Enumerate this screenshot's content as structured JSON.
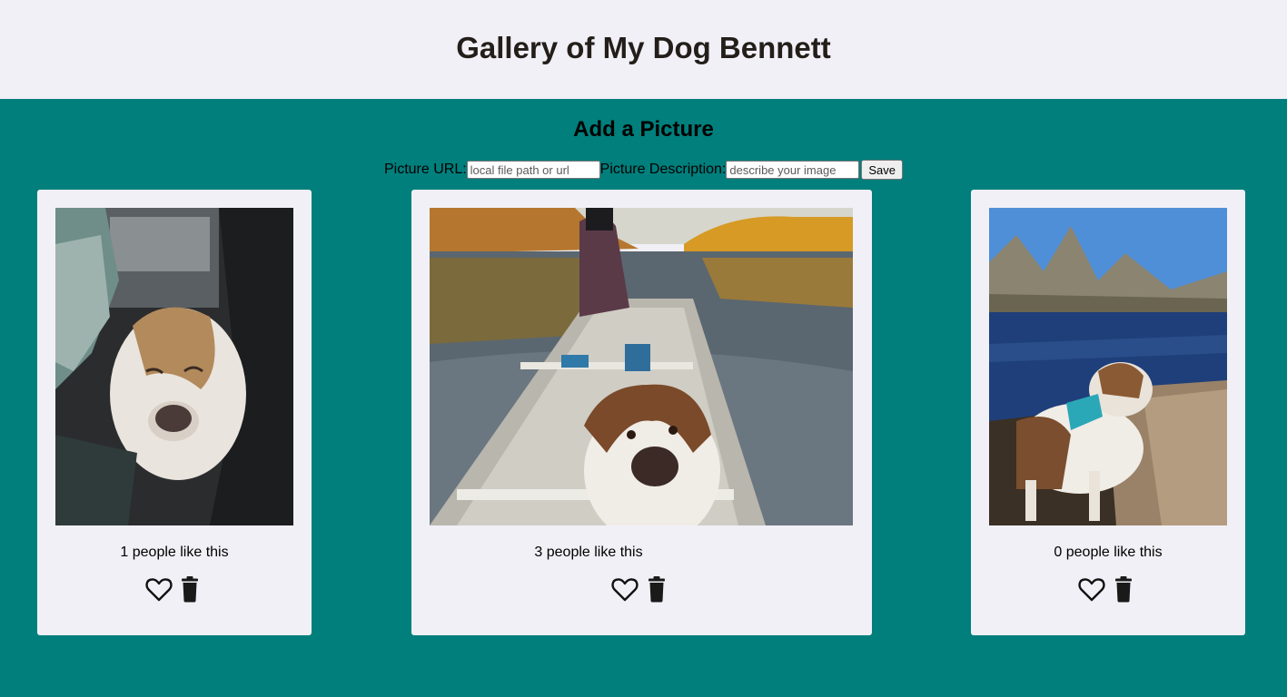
{
  "header": {
    "title": "Gallery of My Dog Bennett"
  },
  "add_form": {
    "title": "Add a Picture",
    "url_label": "Picture URL:",
    "url_placeholder": "local file path or url",
    "desc_label": "Picture Description:",
    "desc_placeholder": "describe your image",
    "save_label": "Save"
  },
  "cards": [
    {
      "likes_text": "1 people like this",
      "icons": [
        "heart-outline-icon",
        "trash-icon"
      ]
    },
    {
      "likes_text": "3 people like this",
      "icons": [
        "heart-outline-icon",
        "trash-icon"
      ]
    },
    {
      "likes_text": "0 people like this",
      "icons": [
        "heart-outline-icon",
        "trash-icon"
      ]
    }
  ],
  "colors": {
    "background": "#007f7c",
    "header_bg": "#f1f0f6",
    "card_bg": "#f1f0f6",
    "title_text": "#231e1a"
  }
}
